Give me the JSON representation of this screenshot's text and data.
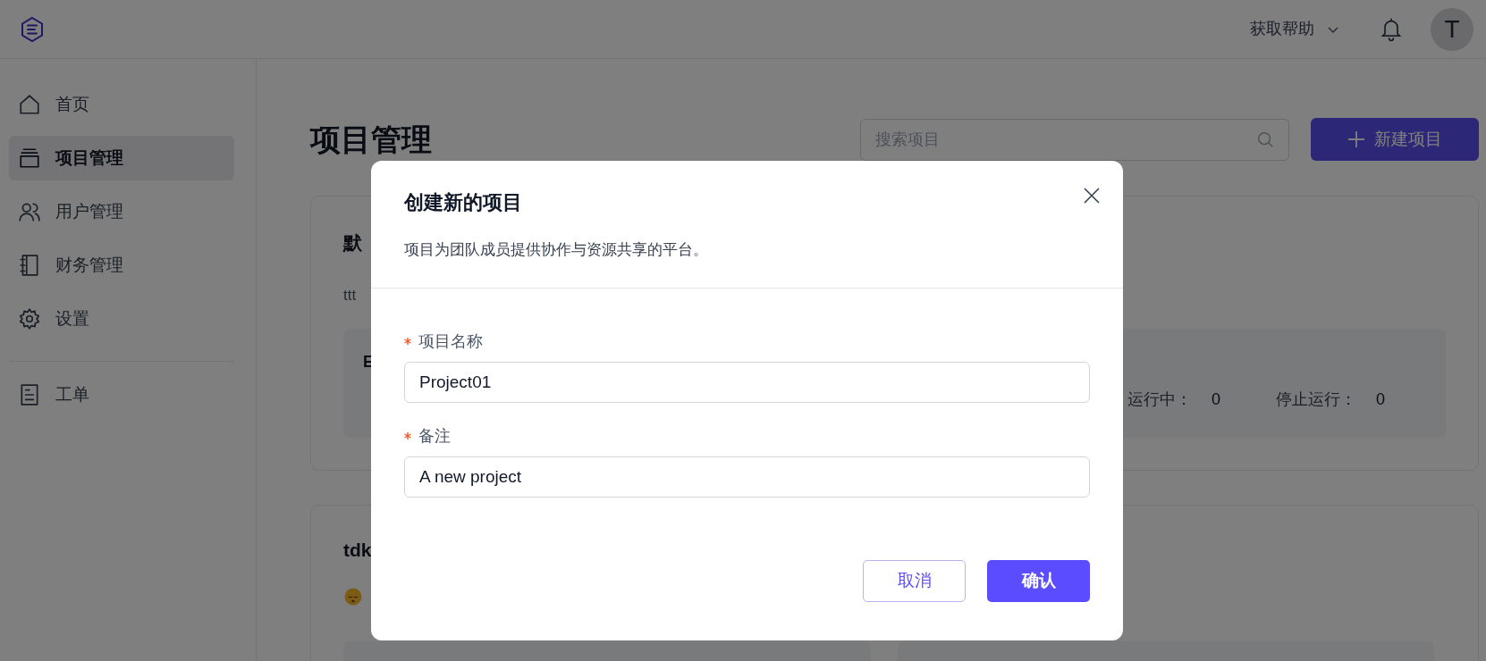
{
  "header": {
    "help_menu": "获取帮助",
    "avatar": "T"
  },
  "sidebar": {
    "items": [
      {
        "label": "首页",
        "selected": false
      },
      {
        "label": "项目管理",
        "selected": true
      },
      {
        "label": "用户管理",
        "selected": false
      },
      {
        "label": "财务管理",
        "selected": false
      },
      {
        "label": "设置",
        "selected": false
      }
    ],
    "footer_items": [
      {
        "label": "工单",
        "selected": false
      }
    ]
  },
  "page": {
    "title": "项目管理",
    "search": {
      "placeholder": "搜索项目"
    },
    "new_button": "新建项目"
  },
  "cards": [
    {
      "title": "默",
      "description": "ttt",
      "panel": {
        "name": "E",
        "stats": [
          {
            "label": "运行中：",
            "value": "0"
          },
          {
            "label": "停止运行：",
            "value": "0"
          }
        ]
      }
    },
    {
      "title": "tdk"
    }
  ],
  "modal": {
    "title": "创建新的项目",
    "description": "项目为团队成员提供协作与资源共享的平台。",
    "fields": [
      {
        "label": "项目名称",
        "required": true,
        "value": "Project01"
      },
      {
        "label": "备注",
        "required": true,
        "value": "A new project"
      }
    ],
    "buttons": [
      {
        "label": "取消",
        "kind": "secondary"
      },
      {
        "label": "确认",
        "kind": "primary"
      }
    ]
  }
}
